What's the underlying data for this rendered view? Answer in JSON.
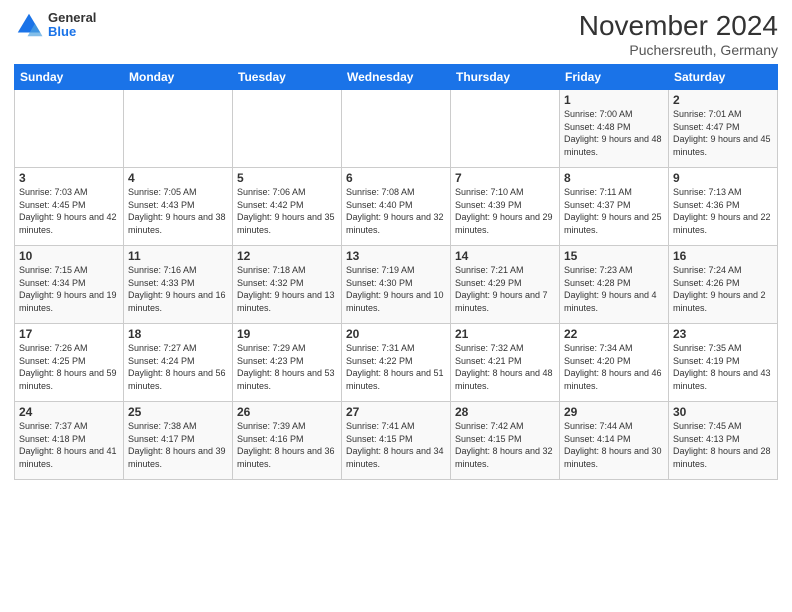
{
  "logo": {
    "general": "General",
    "blue": "Blue"
  },
  "title": "November 2024",
  "subtitle": "Puchersreuth, Germany",
  "days_of_week": [
    "Sunday",
    "Monday",
    "Tuesday",
    "Wednesday",
    "Thursday",
    "Friday",
    "Saturday"
  ],
  "weeks": [
    [
      {
        "day": "",
        "info": ""
      },
      {
        "day": "",
        "info": ""
      },
      {
        "day": "",
        "info": ""
      },
      {
        "day": "",
        "info": ""
      },
      {
        "day": "",
        "info": ""
      },
      {
        "day": "1",
        "info": "Sunrise: 7:00 AM\nSunset: 4:48 PM\nDaylight: 9 hours and 48 minutes."
      },
      {
        "day": "2",
        "info": "Sunrise: 7:01 AM\nSunset: 4:47 PM\nDaylight: 9 hours and 45 minutes."
      }
    ],
    [
      {
        "day": "3",
        "info": "Sunrise: 7:03 AM\nSunset: 4:45 PM\nDaylight: 9 hours and 42 minutes."
      },
      {
        "day": "4",
        "info": "Sunrise: 7:05 AM\nSunset: 4:43 PM\nDaylight: 9 hours and 38 minutes."
      },
      {
        "day": "5",
        "info": "Sunrise: 7:06 AM\nSunset: 4:42 PM\nDaylight: 9 hours and 35 minutes."
      },
      {
        "day": "6",
        "info": "Sunrise: 7:08 AM\nSunset: 4:40 PM\nDaylight: 9 hours and 32 minutes."
      },
      {
        "day": "7",
        "info": "Sunrise: 7:10 AM\nSunset: 4:39 PM\nDaylight: 9 hours and 29 minutes."
      },
      {
        "day": "8",
        "info": "Sunrise: 7:11 AM\nSunset: 4:37 PM\nDaylight: 9 hours and 25 minutes."
      },
      {
        "day": "9",
        "info": "Sunrise: 7:13 AM\nSunset: 4:36 PM\nDaylight: 9 hours and 22 minutes."
      }
    ],
    [
      {
        "day": "10",
        "info": "Sunrise: 7:15 AM\nSunset: 4:34 PM\nDaylight: 9 hours and 19 minutes."
      },
      {
        "day": "11",
        "info": "Sunrise: 7:16 AM\nSunset: 4:33 PM\nDaylight: 9 hours and 16 minutes."
      },
      {
        "day": "12",
        "info": "Sunrise: 7:18 AM\nSunset: 4:32 PM\nDaylight: 9 hours and 13 minutes."
      },
      {
        "day": "13",
        "info": "Sunrise: 7:19 AM\nSunset: 4:30 PM\nDaylight: 9 hours and 10 minutes."
      },
      {
        "day": "14",
        "info": "Sunrise: 7:21 AM\nSunset: 4:29 PM\nDaylight: 9 hours and 7 minutes."
      },
      {
        "day": "15",
        "info": "Sunrise: 7:23 AM\nSunset: 4:28 PM\nDaylight: 9 hours and 4 minutes."
      },
      {
        "day": "16",
        "info": "Sunrise: 7:24 AM\nSunset: 4:26 PM\nDaylight: 9 hours and 2 minutes."
      }
    ],
    [
      {
        "day": "17",
        "info": "Sunrise: 7:26 AM\nSunset: 4:25 PM\nDaylight: 8 hours and 59 minutes."
      },
      {
        "day": "18",
        "info": "Sunrise: 7:27 AM\nSunset: 4:24 PM\nDaylight: 8 hours and 56 minutes."
      },
      {
        "day": "19",
        "info": "Sunrise: 7:29 AM\nSunset: 4:23 PM\nDaylight: 8 hours and 53 minutes."
      },
      {
        "day": "20",
        "info": "Sunrise: 7:31 AM\nSunset: 4:22 PM\nDaylight: 8 hours and 51 minutes."
      },
      {
        "day": "21",
        "info": "Sunrise: 7:32 AM\nSunset: 4:21 PM\nDaylight: 8 hours and 48 minutes."
      },
      {
        "day": "22",
        "info": "Sunrise: 7:34 AM\nSunset: 4:20 PM\nDaylight: 8 hours and 46 minutes."
      },
      {
        "day": "23",
        "info": "Sunrise: 7:35 AM\nSunset: 4:19 PM\nDaylight: 8 hours and 43 minutes."
      }
    ],
    [
      {
        "day": "24",
        "info": "Sunrise: 7:37 AM\nSunset: 4:18 PM\nDaylight: 8 hours and 41 minutes."
      },
      {
        "day": "25",
        "info": "Sunrise: 7:38 AM\nSunset: 4:17 PM\nDaylight: 8 hours and 39 minutes."
      },
      {
        "day": "26",
        "info": "Sunrise: 7:39 AM\nSunset: 4:16 PM\nDaylight: 8 hours and 36 minutes."
      },
      {
        "day": "27",
        "info": "Sunrise: 7:41 AM\nSunset: 4:15 PM\nDaylight: 8 hours and 34 minutes."
      },
      {
        "day": "28",
        "info": "Sunrise: 7:42 AM\nSunset: 4:15 PM\nDaylight: 8 hours and 32 minutes."
      },
      {
        "day": "29",
        "info": "Sunrise: 7:44 AM\nSunset: 4:14 PM\nDaylight: 8 hours and 30 minutes."
      },
      {
        "day": "30",
        "info": "Sunrise: 7:45 AM\nSunset: 4:13 PM\nDaylight: 8 hours and 28 minutes."
      }
    ]
  ]
}
